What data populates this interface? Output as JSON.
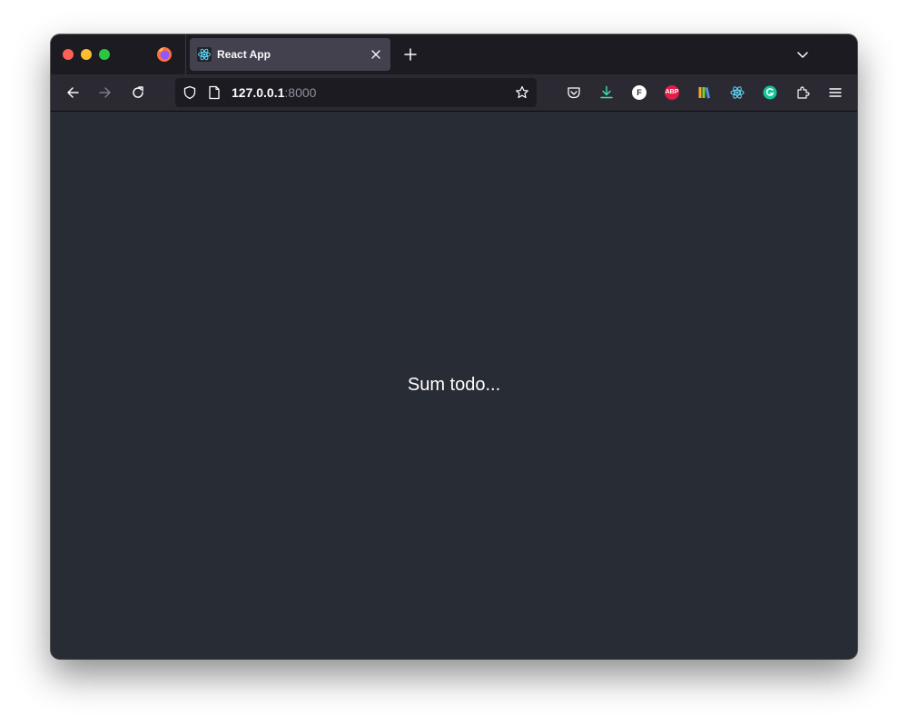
{
  "browser": {
    "tab": {
      "title": "React App",
      "favicon": "react-icon"
    },
    "address": {
      "host": "127.0.0.1",
      "port": ":8000"
    },
    "extensions": [
      {
        "name": "pocket-icon"
      },
      {
        "name": "download-icon",
        "color": "#3fe1b0"
      },
      {
        "name": "feedly-icon",
        "label": "F"
      },
      {
        "name": "adblock-plus-icon",
        "label": "ABP",
        "color": "#e11d48"
      },
      {
        "name": "library-icon"
      },
      {
        "name": "react-devtools-icon",
        "color": "#61dafb"
      },
      {
        "name": "grammarly-icon",
        "color": "#15c39a"
      },
      {
        "name": "extensions-puzzle-icon"
      },
      {
        "name": "menu-icon"
      }
    ]
  },
  "page": {
    "text": "Sum todo..."
  },
  "colors": {
    "page_background": "#282c34",
    "tabstrip": "#1c1b22",
    "toolbar": "#2b2a33"
  }
}
